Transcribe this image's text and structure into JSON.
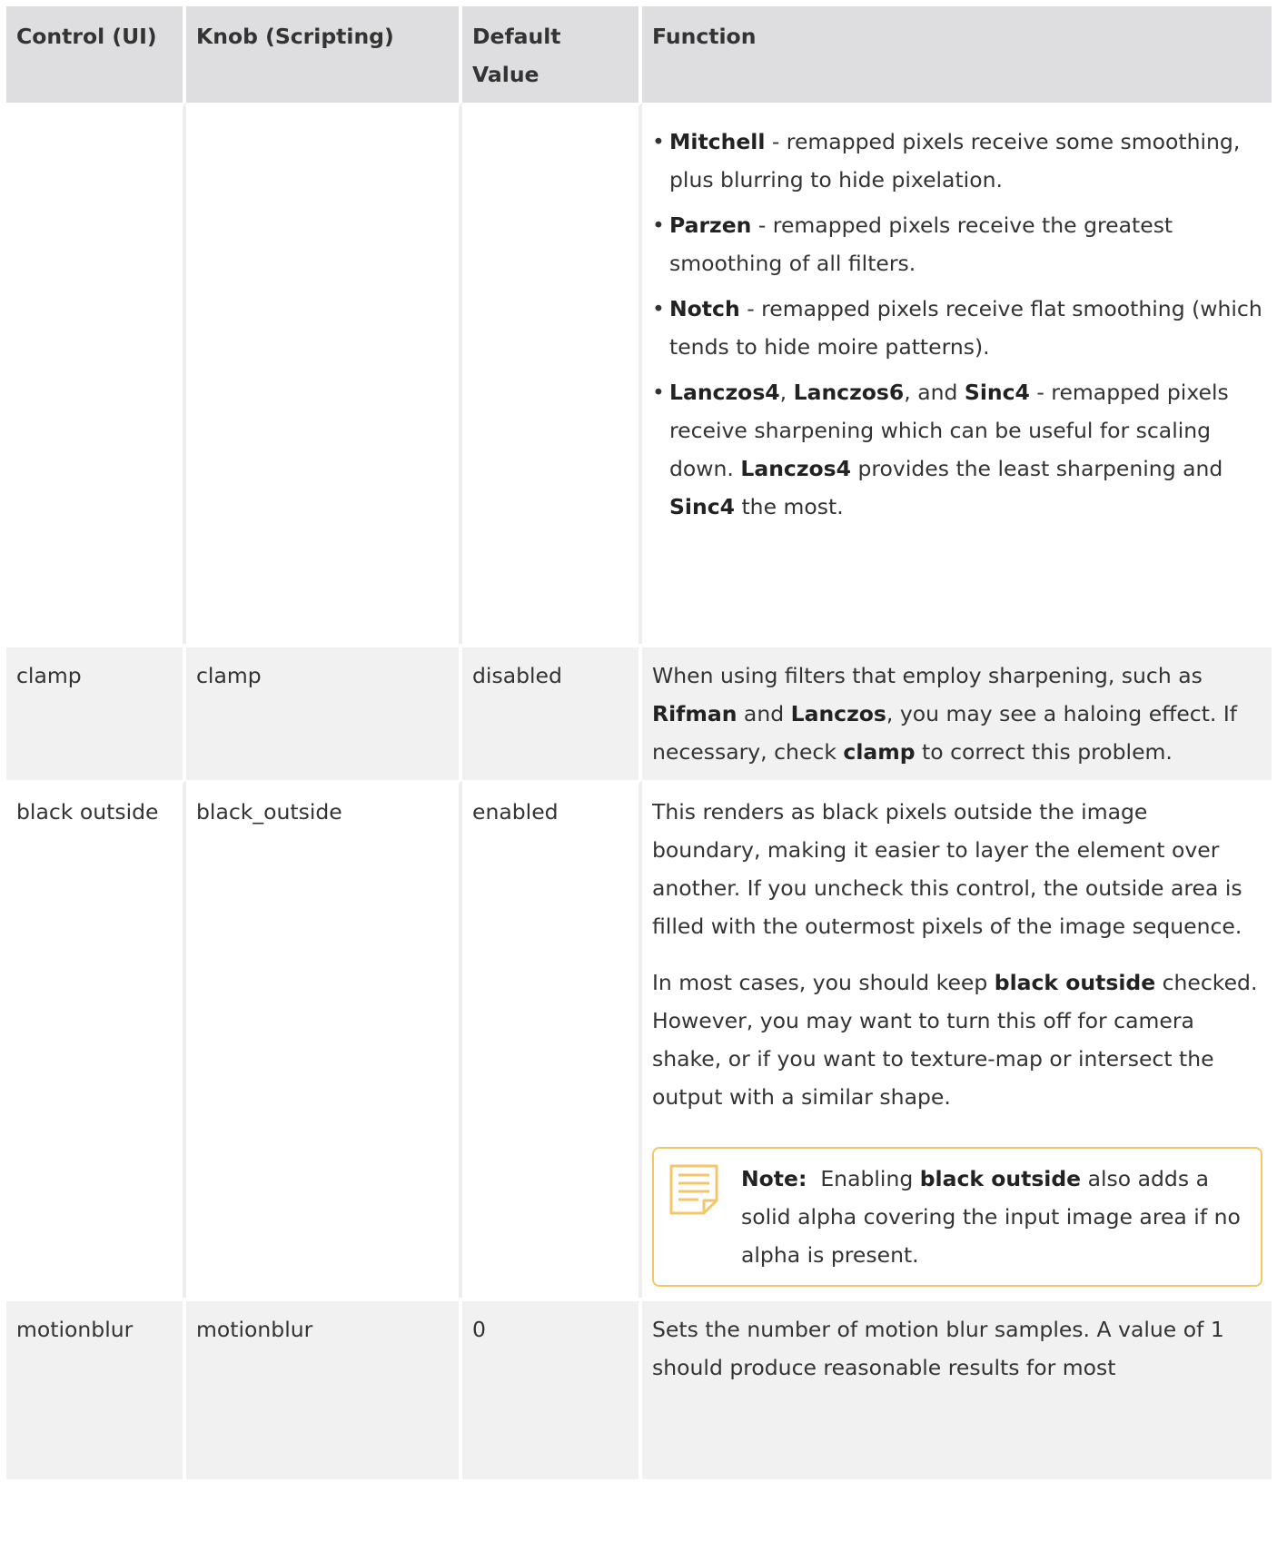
{
  "headers": {
    "control": "Control (UI)",
    "knob": "Knob (Scripting)",
    "default_line1": "Default",
    "default_line2": "Value",
    "function": "Function"
  },
  "filter_row": {
    "items": [
      {
        "bullet": "•",
        "name": "Mitchell",
        "text": " - remapped pixels receive some smoothing, plus blurring to hide pixelation."
      },
      {
        "bullet": "•",
        "name": "Parzen",
        "text": " - remapped pixels receive the greatest smoothing of all filters."
      },
      {
        "bullet": "•",
        "name": "Notch",
        "text": " - remapped pixels receive flat smoothing (which tends to hide moire patterns)."
      }
    ],
    "lanczos": {
      "bullet": "•",
      "name1": "Lanczos4",
      "sep1": ", ",
      "name2": "Lanczos6",
      "sep2": ", and ",
      "name3": "Sinc4",
      "text1": " - remapped pixels receive sharpening which can be useful for scaling down. ",
      "name4": "Lanczos4",
      "text2": " provides the least sharpening and ",
      "name5": "Sinc4",
      "text3": " the most."
    }
  },
  "clamp_row": {
    "control": "clamp",
    "knob": "clamp",
    "default": "disabled",
    "t1": "When using filters that employ sharpening, such as ",
    "b1": "Rifman",
    "t2": " and ",
    "b2": "Lanczos",
    "t3": ", you may see a haloing effect. If necessary, check ",
    "b3": "clamp",
    "t4": " to correct this problem."
  },
  "black_outside_row": {
    "control": "black outside",
    "knob": "black_outside",
    "default": "enabled",
    "p1": "This renders as black pixels outside the image boundary, making it easier to layer the element over another. If you uncheck this control, the outside area is filled with the outermost pixels of the image sequence.",
    "p2_t1": "In most cases, you should keep ",
    "p2_b1": "black outside",
    "p2_t2": " checked. However, you may want to turn this off for camera shake, or if you want to texture-map or intersect the output with a similar shape.",
    "note_label": "Note:",
    "note_t1": "  Enabling ",
    "note_b1": "black outside",
    "note_t2": " also adds a solid alpha covering the input image area if no alpha is present."
  },
  "motionblur_row": {
    "control": "motionblur",
    "knob": "motionblur",
    "default": "0",
    "text": "Sets the number of motion blur samples. A value of 1 should produce reasonable results for most"
  },
  "colors": {
    "header_bg": "#dedee0",
    "grey_row_bg": "#f1f1f1",
    "note_border": "#f4c66a"
  },
  "icons": {
    "note": "note-document-icon"
  }
}
